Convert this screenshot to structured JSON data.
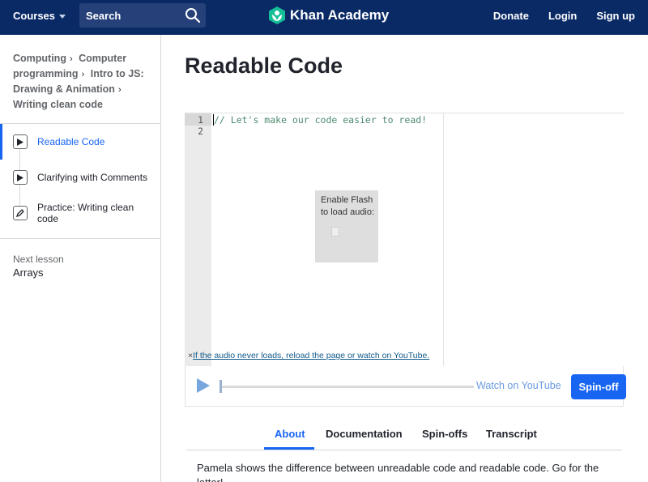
{
  "nav": {
    "courses_label": "Courses",
    "search_placeholder": "Search",
    "logo_text": "Khan Academy",
    "donate": "Donate",
    "login": "Login",
    "signup": "Sign up",
    "bg_color": "#0a2a66",
    "logo_color": "#14bf96"
  },
  "sidebar": {
    "breadcrumb": [
      "Computing",
      "Computer programming",
      "Intro to JS: Drawing & Animation",
      "Writing clean code"
    ],
    "lessons": [
      {
        "label": "Readable Code",
        "icon": "play-icon",
        "active": true
      },
      {
        "label": "Clarifying with Comments",
        "icon": "play-icon",
        "active": false
      },
      {
        "label": "Practice: Writing clean code",
        "icon": "pencil-icon",
        "active": false
      }
    ],
    "next_lesson_title": "Next lesson",
    "next_lesson_name": "Arrays"
  },
  "main": {
    "title": "Readable Code",
    "editor": {
      "line_numbers": [
        "1",
        "2"
      ],
      "code_lines": [
        "// Let's make our code easier to read!",
        ""
      ],
      "flash_message": "Enable Flash to load audio:",
      "audio_note_x": "×",
      "audio_note_link": "If the audio never loads, reload the page or watch on YouTube."
    },
    "player": {
      "watch_on_youtube": "Watch on YouTube",
      "spinoff_label": "Spin-off",
      "accent": "#1865f2"
    },
    "tabs": [
      {
        "label": "About",
        "active": true
      },
      {
        "label": "Documentation",
        "active": false
      },
      {
        "label": "Spin-offs",
        "active": false
      },
      {
        "label": "Transcript",
        "active": false
      }
    ],
    "description": "Pamela shows the difference between unreadable code and readable code. Go for the latter!"
  }
}
